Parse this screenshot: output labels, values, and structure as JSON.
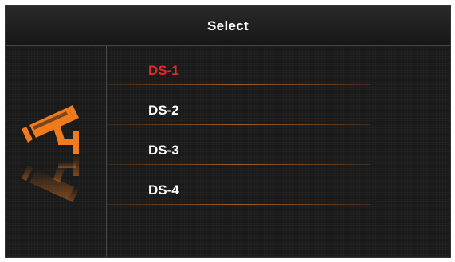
{
  "header": {
    "title": "Select"
  },
  "menu": {
    "items": [
      {
        "label": "DS-1",
        "selected": true
      },
      {
        "label": "DS-2",
        "selected": false
      },
      {
        "label": "DS-3",
        "selected": false
      },
      {
        "label": "DS-4",
        "selected": false
      }
    ]
  },
  "colors": {
    "accent": "#f07a1e",
    "selected_text": "#e8262a",
    "text": "#ffffff",
    "background": "#1a1a1a"
  },
  "icons": {
    "camera": "cctv-camera-icon"
  }
}
